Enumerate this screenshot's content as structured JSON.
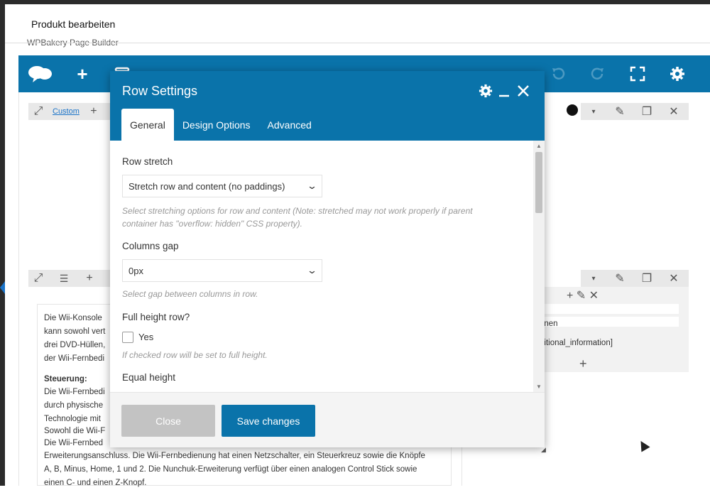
{
  "page": {
    "title": "Produkt bearbeiten",
    "builder_label": "WPBakery Page Builder"
  },
  "row1": {
    "custom_link": "Custom"
  },
  "content": {
    "lines": [
      "Die Wii-Konsole",
      "kann sowohl vert",
      "drei DVD-Hüllen,",
      "der Wii-Fernbedi"
    ],
    "heading": "Steuerung:",
    "lines2": [
      "Die Wii-Fernbedi",
      "durch physische",
      "Technologie mit",
      "Sowohl die Wii-F",
      "Die Wii-Fernbed",
      "Erweiterungsanschluss. Die Wii-Fernbedienung hat einen Netzschalter, ein Steuerkreuz sowie die Knöpfe",
      "A, B, Minus, Home, 1 und 2. Die Nunchuk-Erweiterung verfügt über einen analogen Control Stick sowie",
      "einen C- und einen Z-Knopf."
    ]
  },
  "right_panel": {
    "text1": "onen",
    "text2": "ditional_information]"
  },
  "modal": {
    "title": "Row Settings",
    "tabs": [
      {
        "label": "General"
      },
      {
        "label": "Design Options"
      },
      {
        "label": "Advanced"
      }
    ],
    "row_stretch": {
      "label": "Row stretch",
      "value": "Stretch row and content (no paddings)",
      "help_line1": "Select stretching options for row and content (Note: stretched may not work properly if parent",
      "help_line2": "container has \"overflow: hidden\" CSS property)."
    },
    "columns_gap": {
      "label": "Columns gap",
      "value": "0px",
      "help": "Select gap between columns in row."
    },
    "full_height": {
      "label": "Full height row?",
      "checkbox_label": "Yes",
      "checked": false,
      "help": "If checked row will be set to full height."
    },
    "equal_height": {
      "label": "Equal height"
    },
    "footer": {
      "close_label": "Close",
      "save_label": "Save changes"
    }
  },
  "colors": {
    "brand": "#0a73aa",
    "close_button": "#c3c3c3",
    "help_text": "#999999"
  },
  "icons": {
    "toolbar": [
      "logo-icon",
      "add-element-icon",
      "templates-icon",
      "undo-icon",
      "redo-icon",
      "fullscreen-icon",
      "settings-icon"
    ],
    "modal": [
      "gear-icon",
      "minimize-icon",
      "close-icon"
    ]
  }
}
